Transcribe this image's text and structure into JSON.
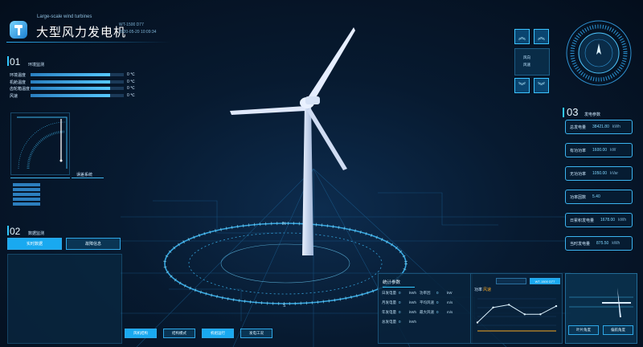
{
  "header": {
    "subtitle_en": "Large-scale wind turbines",
    "title": "大型风力发电机",
    "model": "WT-1500 D77",
    "datetime": "2020-05-20 10:09:34"
  },
  "section1": {
    "num": "01",
    "label": "环境监测",
    "rows": [
      {
        "label": "环境温度",
        "value": "0 ℃",
        "fill": 0.85
      },
      {
        "label": "机舱温度",
        "value": "0 ℃",
        "fill": 0.85
      },
      {
        "label": "齿轮箱温度",
        "value": "0 ℃",
        "fill": 0.85
      },
      {
        "label": "风速",
        "value": "0 ℃",
        "fill": 0.85
      }
    ],
    "gauge_label": "误差系统"
  },
  "section2": {
    "num": "02",
    "label": "数据监测",
    "tab_active": "实时数据",
    "tab_inactive": "故障信息"
  },
  "section3": {
    "num": "03",
    "label": "发电参数",
    "params": [
      {
        "label": "总发电量",
        "value": "38421.80",
        "unit": "kWh"
      },
      {
        "label": "有功功率",
        "value": "1600.00",
        "unit": "kW"
      },
      {
        "label": "无功功率",
        "value": "1050.00",
        "unit": "kVar"
      },
      {
        "label": "功率因数",
        "value": "5.40",
        "unit": ""
      },
      {
        "label": "日累积发电量",
        "value": "1678.00",
        "unit": "kWh"
      },
      {
        "label": "当时发电量",
        "value": "875.50",
        "unit": "kWh"
      }
    ]
  },
  "right_top": {
    "mini_label1": "风向",
    "mini_label2": "风速"
  },
  "bottom_buttons": [
    "风机结构",
    "结构模式",
    "机组运行",
    "发电工况"
  ],
  "stats_panel": {
    "title": "统计参数",
    "rows": [
      {
        "a": "日发电量",
        "av": "0",
        "au": "kWh",
        "b": "功率因",
        "bv": "0",
        "bu": "kW"
      },
      {
        "a": "月发电量",
        "av": "0",
        "au": "kWh",
        "b": "平均风速",
        "bv": "0",
        "bu": "m/s"
      },
      {
        "a": "年发电量",
        "av": "0",
        "au": "kWh",
        "b": "最大风速",
        "bv": "0",
        "bu": "m/s"
      },
      {
        "a": "总发电量",
        "av": "0",
        "au": "kWh",
        "b": "",
        "bv": "",
        "bu": ""
      }
    ]
  },
  "chart_panel": {
    "label1": "功率",
    "label2": "风速",
    "tab1": "",
    "tab2": "WT-1500 D77"
  },
  "right_bottom": {
    "btn1": "叶片角度",
    "btn2": "偏航角度"
  },
  "chart_data": {
    "type": "line",
    "x": [
      0,
      1,
      2,
      3,
      4,
      5
    ],
    "values": [
      0.25,
      0.8,
      0.9,
      0.55,
      0.55,
      0.85
    ],
    "title": "",
    "xlabel": "",
    "ylabel": ""
  },
  "colors": {
    "accent": "#31c7ff",
    "orange": "#f5a623",
    "panel": "#0a2a46"
  }
}
